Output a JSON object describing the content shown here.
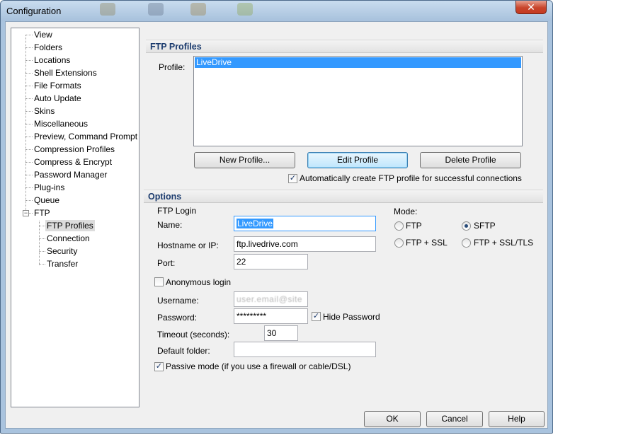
{
  "window": {
    "title": "Configuration",
    "close_glyph": "✕"
  },
  "tree": {
    "items": [
      {
        "label": "View"
      },
      {
        "label": "Folders"
      },
      {
        "label": "Locations"
      },
      {
        "label": "Shell Extensions"
      },
      {
        "label": "File Formats"
      },
      {
        "label": "Auto Update"
      },
      {
        "label": "Skins"
      },
      {
        "label": "Miscellaneous"
      },
      {
        "label": "Preview, Command Prompt"
      },
      {
        "label": "Compression Profiles"
      },
      {
        "label": "Compress & Encrypt"
      },
      {
        "label": "Password Manager"
      },
      {
        "label": "Plug-ins"
      },
      {
        "label": "Queue"
      },
      {
        "label": "FTP",
        "expander": "−"
      }
    ],
    "children": [
      {
        "label": "FTP Profiles",
        "selected": true
      },
      {
        "label": "Connection"
      },
      {
        "label": "Security"
      },
      {
        "label": "Transfer"
      }
    ]
  },
  "profiles": {
    "header": "FTP Profiles",
    "label": "Profile:",
    "list": [
      "LiveDrive"
    ],
    "new_button": "New Profile...",
    "edit_button": "Edit Profile",
    "delete_button": "Delete Profile",
    "auto_create_label": "Automatically create FTP profile for successful connections",
    "auto_create_checked": true
  },
  "options": {
    "header": "Options",
    "ftp_login_label": "FTP Login",
    "name_label": "Name:",
    "name_value": "LiveDrive",
    "hostname_label": "Hostname or IP:",
    "hostname_value": "ftp.livedrive.com",
    "port_label": "Port:",
    "port_value": "22",
    "anonymous_label": "Anonymous login",
    "anonymous_checked": false,
    "username_label": "Username:",
    "username_value": "user.email@site",
    "password_label": "Password:",
    "password_value": "*********",
    "hide_password_label": "Hide Password",
    "hide_password_checked": true,
    "timeout_label": "Timeout (seconds):",
    "timeout_value": "30",
    "default_folder_label": "Default folder:",
    "default_folder_value": "",
    "passive_label": "Passive mode (if you use a firewall or cable/DSL)",
    "passive_checked": true,
    "mode_label": "Mode:",
    "modes": [
      {
        "label": "FTP",
        "selected": false
      },
      {
        "label": "SFTP",
        "selected": true
      },
      {
        "label": "FTP + SSL",
        "selected": false
      },
      {
        "label": "FTP + SSL/TLS",
        "selected": false
      }
    ]
  },
  "footer": {
    "ok": "OK",
    "cancel": "Cancel",
    "help": "Help"
  },
  "colors": {
    "selection": "#3399ff",
    "section_header_text": "#1b3b6e",
    "titlebar": "#a7c1dc"
  }
}
